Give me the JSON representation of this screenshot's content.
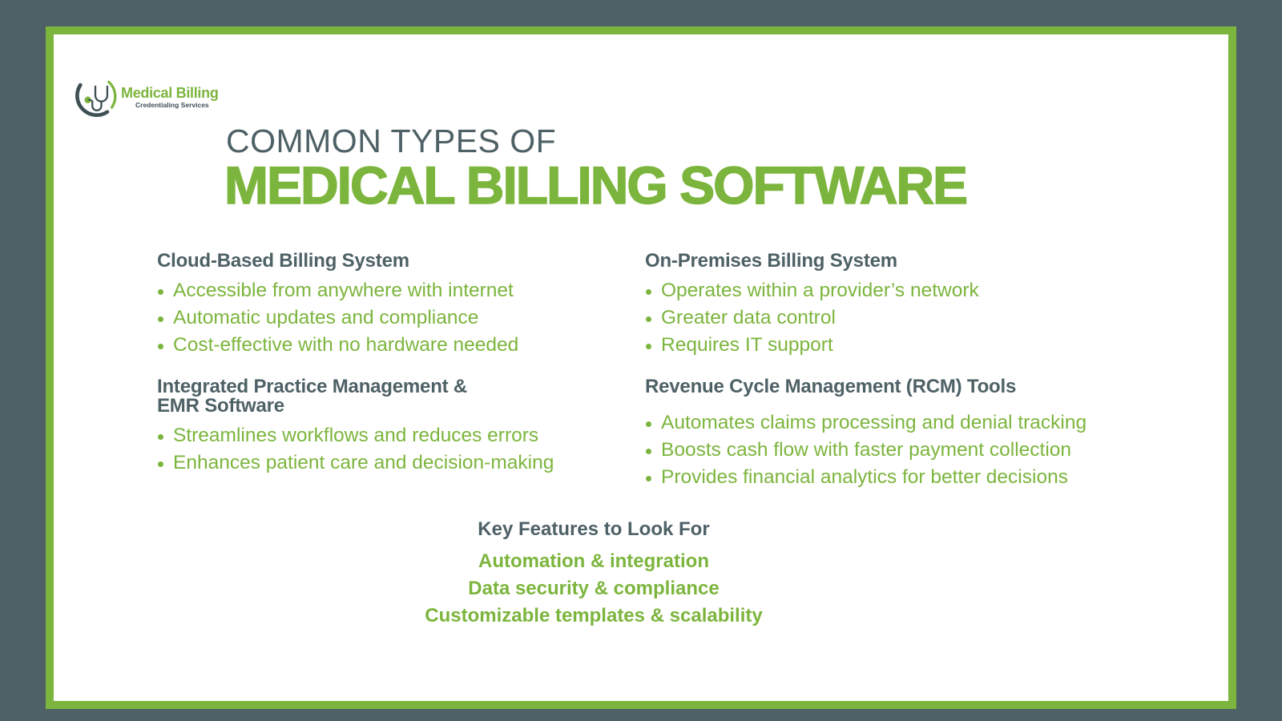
{
  "logo": {
    "icon": "stethoscope-icon",
    "name": "Medical Billing",
    "subtitle": "Credentialing Services"
  },
  "title": {
    "line1": "COMMON TYPES OF",
    "line2": "MEDICAL BILLING SOFTWARE"
  },
  "sections": [
    {
      "heading": "Cloud-Based Billing System",
      "items": [
        "Accessible from anywhere with internet",
        "Automatic updates and compliance",
        "Cost-effective with no hardware needed"
      ]
    },
    {
      "heading": "On-Premises Billing System",
      "items": [
        "Operates within a provider’s network",
        "Greater data control",
        "Requires IT support"
      ]
    },
    {
      "heading_line1": "Integrated Practice Management &",
      "heading_line2": "EMR Software",
      "items": [
        "Streamlines workflows and reduces errors",
        "Enhances patient care and decision-making"
      ]
    },
    {
      "heading": "Revenue Cycle Management (RCM) Tools",
      "items": [
        "Automates claims processing and denial tracking",
        "Boosts cash flow with faster payment collection",
        "Provides financial analytics for better decisions"
      ]
    }
  ],
  "features": {
    "heading": "Key Features to Look For",
    "items": [
      "Automation & integration",
      "Data security & compliance",
      "Customizable templates & scalability"
    ]
  },
  "colors": {
    "brand_green": "#7cb53d",
    "slate": "#4e6166",
    "background": "#ffffff"
  }
}
